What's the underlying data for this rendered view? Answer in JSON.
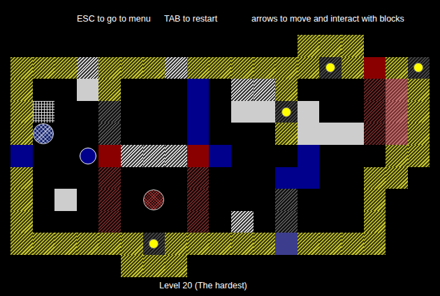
{
  "hints": [
    "ESC to go to menu",
    "TAB to restart",
    "arrows to move and interact with blocks"
  ],
  "board": {
    "rows": [
      ".............YYY...",
      "YYYWYYYWYYYYYYDYRYD",
      "Y..GY...B.WWY...XKY",
      "YM..H...B.GGDG..XKY",
      "YO..H...B...YGGGXKY",
      "B..PRWWWRB...B...YY",
      "Y...X...X...BB..YY.",
      "Y.G.X.C.X...H...Y..",
      "Y...X...X.W.H...Y..",
      "YYYYYYDYYYYYVYYYY..",
      ".....YYY..........."
    ]
  },
  "level_label": "Level 20 (The hardest)"
}
